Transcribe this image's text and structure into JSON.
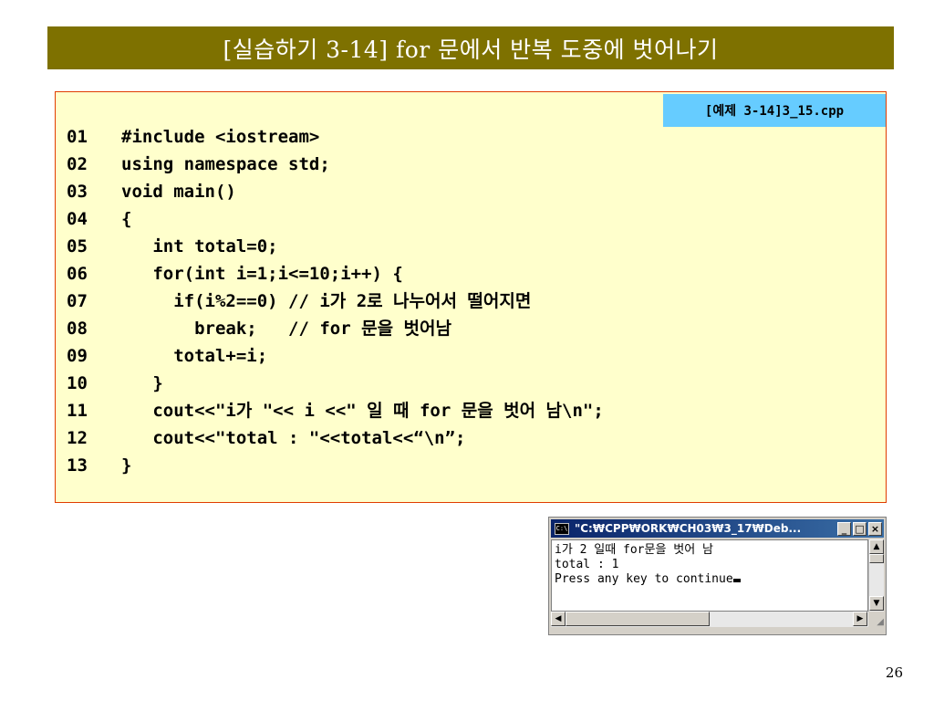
{
  "slide": {
    "title": "[실습하기 3-14] for 문에서 반복 도중에 벗어나기",
    "page_number": "26"
  },
  "code_box": {
    "file_tag": "[예제 3-14]3_15.cpp",
    "lines": [
      {
        "num": "01",
        "code": "#include <iostream>"
      },
      {
        "num": "02",
        "code": "using namespace std;"
      },
      {
        "num": "03",
        "code": "void main()"
      },
      {
        "num": "04",
        "code": "{"
      },
      {
        "num": "05",
        "code": "   int total=0;"
      },
      {
        "num": "06",
        "code": "   for(int i=1;i<=10;i++) {"
      },
      {
        "num": "07",
        "code": "     if(i%2==0) // i가 2로 나누어서 떨어지면"
      },
      {
        "num": "08",
        "code": "       break;   // for 문을 벗어남"
      },
      {
        "num": "09",
        "code": "     total+=i;"
      },
      {
        "num": "10",
        "code": "   }"
      },
      {
        "num": "11",
        "code": "   cout<<\"i가 \"<< i <<\" 일 때 for 문을 벗어 남\\n\";"
      },
      {
        "num": "12",
        "code": "   cout<<\"total : \"<<total<<“\\n”;"
      },
      {
        "num": "13",
        "code": "}"
      }
    ]
  },
  "console": {
    "icon_label": "C:\\",
    "title": "\"C:₩CPP₩ORK₩CH03₩3_17₩Deb...",
    "buttons": {
      "minimize": "_",
      "maximize": "□",
      "close": "×"
    },
    "output_lines": [
      "i가 2 일때 for문을 벗어 남",
      "total : 1",
      "Press any key to continue"
    ],
    "scroll_arrows": {
      "up": "▲",
      "down": "▼",
      "left": "◀",
      "right": "▶"
    },
    "grip": "◢"
  },
  "colors": {
    "title_bar": "#7e7100",
    "code_background": "#ffffcc",
    "code_border": "#e03c00",
    "file_tag_background": "#66ccff"
  }
}
